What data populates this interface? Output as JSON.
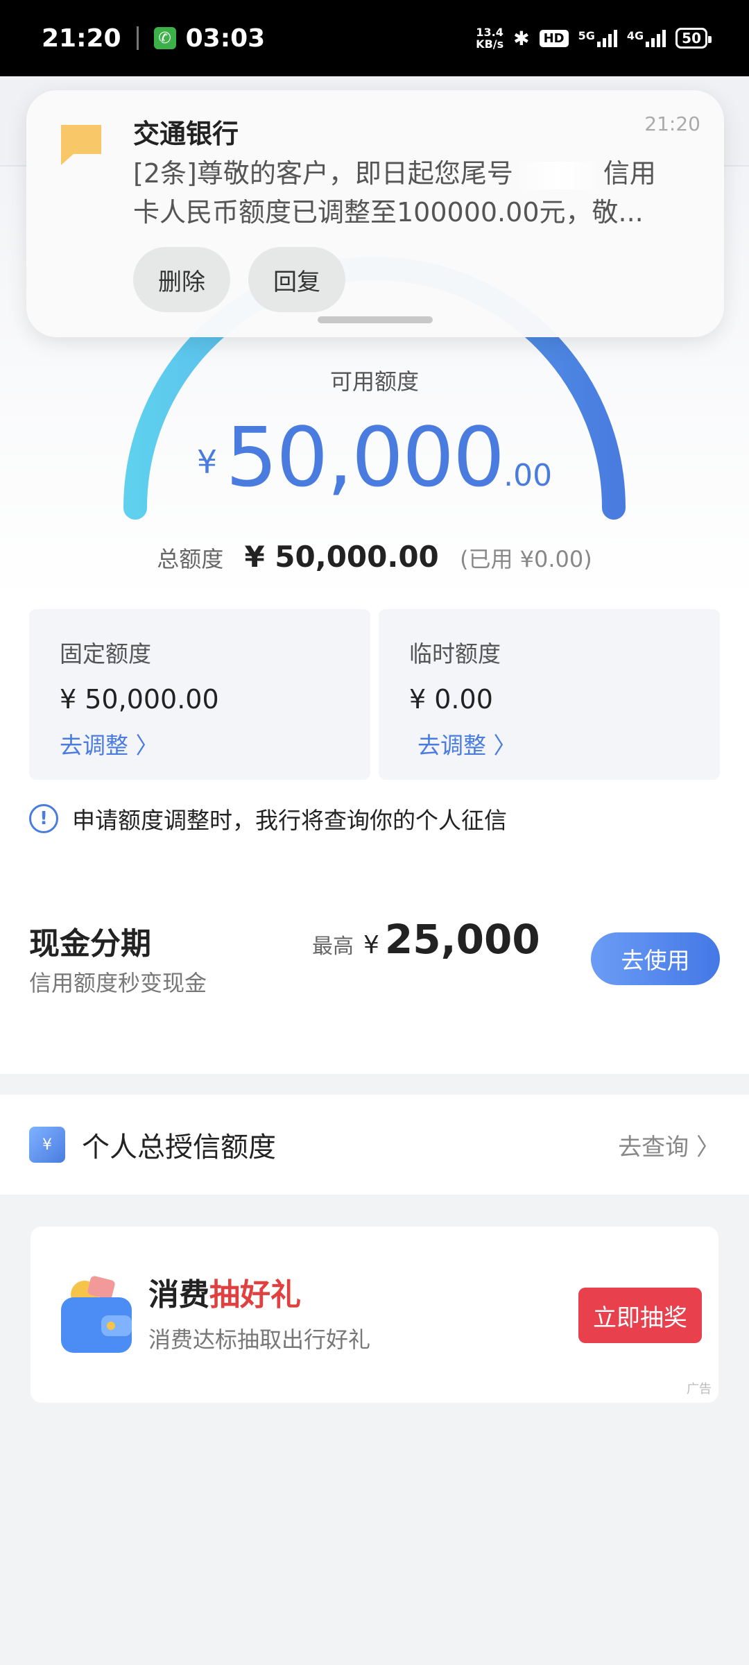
{
  "status_bar": {
    "time": "21:20",
    "call_time": "03:03",
    "net_speed_top": "13.4",
    "net_speed_bottom": "KB/s",
    "hd": "HD",
    "net1": "5G",
    "net2": "4G",
    "battery": "50",
    "icons": [
      "phone-icon",
      "bluetooth-icon",
      "signal-icon",
      "battery-icon"
    ]
  },
  "notification": {
    "app_name": "交通银行",
    "time": "21:20",
    "line1": "[2条]尊敬的客户，即日起您尾号",
    "line1_tail": "信用",
    "line2": "卡人民币额度已调整至100000.00元，敬...",
    "delete_label": "删除",
    "reply_label": "回复"
  },
  "gauge": {
    "label": "可用额度",
    "currency": "¥",
    "amount_int": "50,000",
    "amount_dec": ".00",
    "used_fraction": 0,
    "colors": {
      "start": "#5fd0ee",
      "end": "#4a7ce0"
    }
  },
  "totals": {
    "label": "总额度",
    "value": "¥ 50,000.00",
    "used": "(已用 ¥0.00)"
  },
  "limits": [
    {
      "title": "固定额度",
      "value": "¥ 50,000.00",
      "link": "去调整 〉"
    },
    {
      "title": "临时额度",
      "value": "¥ 0.00",
      "link": "去调整 〉"
    }
  ],
  "notice": {
    "icon": "info-icon",
    "text": "申请额度调整时，我行将查询你的个人征信"
  },
  "cash": {
    "title": "现金分期",
    "subtitle": "信用额度秒变现金",
    "max_label": "最高",
    "currency": "¥",
    "max_value": "25,000",
    "button": "去使用"
  },
  "credit": {
    "title": "个人总授信额度",
    "link": "去查询 〉",
    "icon": "yen-screen-icon"
  },
  "ad": {
    "title_plain": "消费",
    "title_highlight": "抽好礼",
    "subtitle": "消费达标抽取出行好礼",
    "button": "立即抽奖",
    "tag": "广告",
    "accent": "#e0403f"
  }
}
